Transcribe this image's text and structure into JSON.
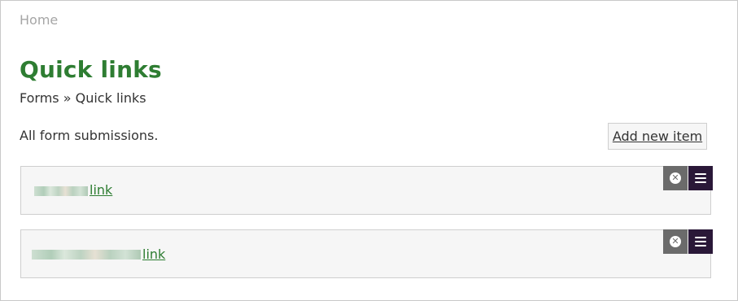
{
  "breadcrumb_top": {
    "home": "Home"
  },
  "page": {
    "title": "Quick links",
    "breadcrumb": {
      "forms": "Forms",
      "separator": "»",
      "current": "Quick links"
    },
    "description": "All form submissions.",
    "add_button": "Add new item"
  },
  "items": [
    {
      "link_text": "link",
      "remove_icon": "close-circle-icon",
      "menu_icon": "hamburger-icon"
    },
    {
      "link_text": "link",
      "remove_icon": "close-circle-icon",
      "menu_icon": "hamburger-icon"
    }
  ],
  "colors": {
    "title_green": "#2e7d32",
    "link_green": "#2e7d32",
    "menu_button": "#2a1838",
    "remove_button": "#6b6b6b"
  }
}
